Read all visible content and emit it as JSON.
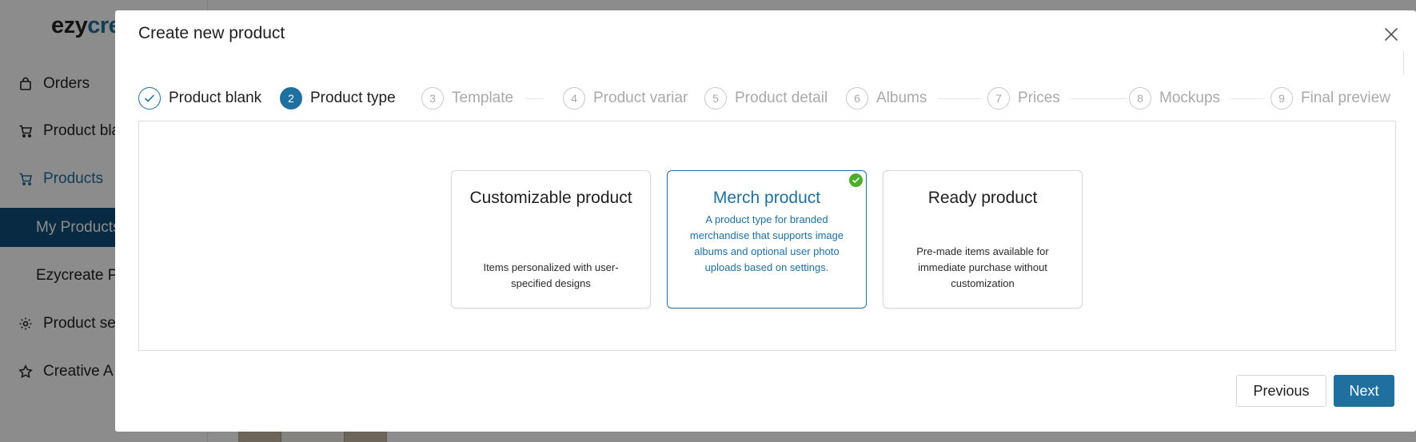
{
  "background": {
    "logo": {
      "part1": "ezy",
      "part2": "cre"
    },
    "nav": [
      {
        "label": "Orders",
        "icon": "bag-icon"
      },
      {
        "label": "Product bla",
        "icon": "cart-icon"
      },
      {
        "label": "Products",
        "icon": "cart-icon"
      },
      {
        "label": "My Products"
      },
      {
        "label": "Ezycreate P"
      },
      {
        "label": "Product se",
        "icon": "gear-icon"
      },
      {
        "label": "Creative A",
        "icon": "star-icon"
      }
    ]
  },
  "modal": {
    "title": "Create new product",
    "steps": [
      {
        "number": "1",
        "label": "Product blank",
        "state": "done"
      },
      {
        "number": "2",
        "label": "Product type",
        "state": "current"
      },
      {
        "number": "3",
        "label": "Template",
        "state": "pending"
      },
      {
        "number": "4",
        "label": "Product variar",
        "state": "pending"
      },
      {
        "number": "5",
        "label": "Product detail",
        "state": "pending"
      },
      {
        "number": "6",
        "label": "Albums",
        "state": "pending"
      },
      {
        "number": "7",
        "label": "Prices",
        "state": "pending"
      },
      {
        "number": "8",
        "label": "Mockups",
        "state": "pending"
      },
      {
        "number": "9",
        "label": "Final preview",
        "state": "pending"
      }
    ],
    "cards": [
      {
        "title": "Customizable product",
        "description": "Items personalized with user-specified designs",
        "selected": false
      },
      {
        "title": "Merch product",
        "description": "A product type for branded merchandise that supports image albums and optional user photo uploads based on settings.",
        "selected": true
      },
      {
        "title": "Ready product",
        "description": "Pre-made items available for immediate purchase without customization",
        "selected": false
      }
    ],
    "buttons": {
      "previous": "Previous",
      "next": "Next"
    }
  },
  "colors": {
    "accent": "#1f6f9f",
    "sidebar_selected": "#0f4f7a",
    "check": "#4caf28"
  }
}
